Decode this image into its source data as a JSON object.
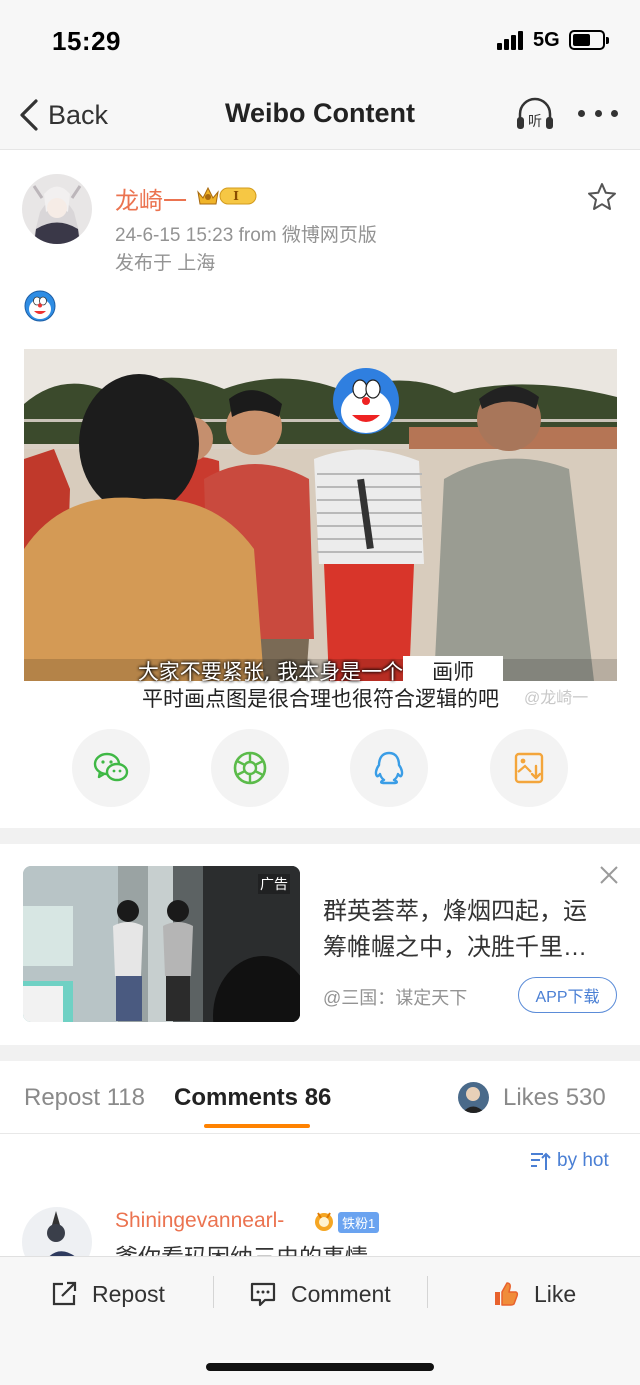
{
  "status_bar": {
    "time": "15:29",
    "network": "5G",
    "battery_level": 0.6
  },
  "nav": {
    "back_label": "Back",
    "title": "Weibo Content",
    "listen_icon": "listen-icon",
    "more_icon": "more-icon"
  },
  "post": {
    "author": "龙崎一",
    "meta": "24-6-15 15:23  from 微博网页版",
    "location": "发布于 上海",
    "emoji_icon": "doraemon-emoji",
    "image": {
      "caption_line1": "大家不要紧张, 我本身是一个",
      "caption_redacted": "画师",
      "caption_line2": "平时画点图是很合理也很符合逻辑的吧",
      "watermark": "@龙崎一"
    }
  },
  "share": [
    {
      "name": "wechat",
      "icon": "wechat-icon",
      "color": "#3fb845"
    },
    {
      "name": "moments",
      "icon": "moments-icon",
      "color": "#5bbb4a"
    },
    {
      "name": "qq",
      "icon": "qq-icon",
      "color": "#3a9de6"
    },
    {
      "name": "save-image",
      "icon": "save-image-icon",
      "color": "#f3a53b"
    }
  ],
  "ad": {
    "tag": "广告",
    "text": "群英荟萃，烽烟四起，运筹帷幄之中，决胜千里…",
    "source": "@三国：谋定天下",
    "button": "APP下载"
  },
  "tabs": {
    "repost": "Repost 118",
    "comments": "Comments 86",
    "likes": "Likes 530"
  },
  "sort_label": "by hot",
  "comment": {
    "user": "Shiningevannearl-",
    "fan_badge": "铁粉1",
    "text": "爹你看玛困纳三史的事情"
  },
  "bottom_bar": {
    "repost": "Repost",
    "comment": "Comment",
    "like": "Like"
  },
  "colors": {
    "accent_orange": "#ff8200",
    "name_orange": "#eb7350",
    "link_blue": "#4a7fd4"
  }
}
